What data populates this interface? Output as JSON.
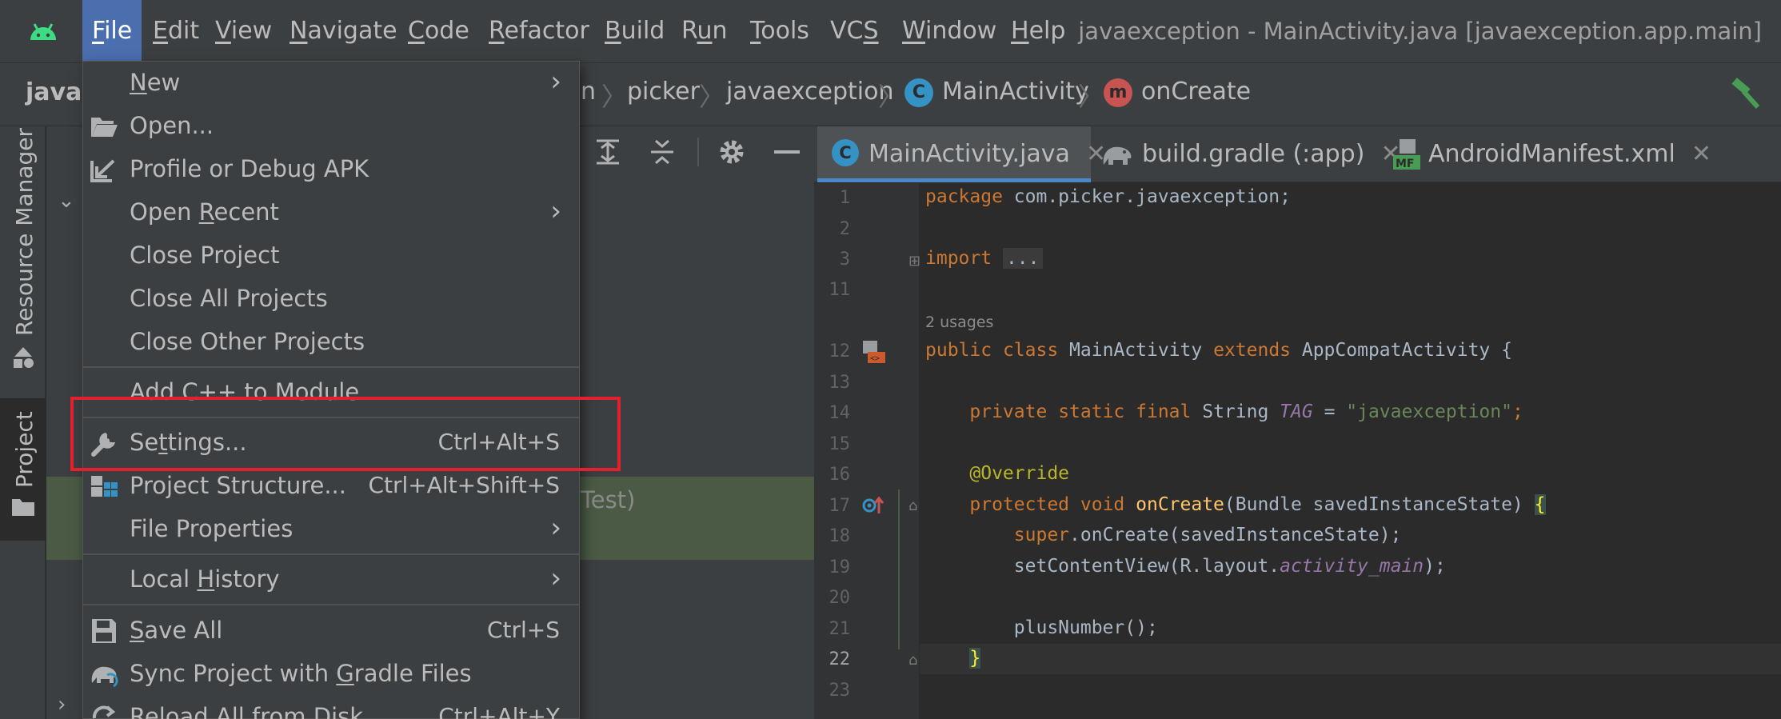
{
  "menubar": {
    "items": [
      {
        "label": "File",
        "mnemonic": "F",
        "rest": "ile"
      },
      {
        "label": "Edit",
        "mnemonic": "E",
        "rest": "dit"
      },
      {
        "label": "View",
        "mnemonic": "V",
        "rest": "iew"
      },
      {
        "label": "Navigate",
        "mnemonic": "N",
        "rest": "avigate"
      },
      {
        "label": "Code",
        "mnemonic": "C",
        "rest": "ode"
      },
      {
        "label": "Refactor",
        "mnemonic": "R",
        "rest": "efactor"
      },
      {
        "label": "Build",
        "mnemonic": "B",
        "rest": "uild"
      },
      {
        "label": "Run",
        "pre": "R",
        "mnemonic": "u",
        "rest": "n"
      },
      {
        "label": "Tools",
        "mnemonic": "T",
        "rest": "ools"
      },
      {
        "label": "VCS",
        "pre": "VC",
        "mnemonic": "S",
        "rest": ""
      },
      {
        "label": "Window",
        "mnemonic": "W",
        "rest": "indow"
      },
      {
        "label": "Help",
        "mnemonic": "H",
        "rest": "elp"
      }
    ],
    "window_title": "javaexception - MainActivity.java [javaexception.app.main]"
  },
  "navbar": {
    "project_name": "javae",
    "crumbs": [
      "n",
      "picker",
      "javaexception",
      "MainActivity",
      "onCreate"
    ],
    "class_badge": "C",
    "method_badge": "m"
  },
  "left_strip": {
    "resource_manager": "Resource Manager",
    "project": "Project"
  },
  "project_panel": {
    "selected_row_text": "Test)"
  },
  "editor": {
    "tabs": [
      {
        "label": "MainActivity.java",
        "icon": "java-class-icon",
        "active": true
      },
      {
        "label": "build.gradle (:app)",
        "icon": "gradle-elephant-icon",
        "active": false
      },
      {
        "label": "AndroidManifest.xml",
        "icon": "manifest-icon",
        "active": false
      }
    ],
    "line_numbers": [
      "1",
      "2",
      "3",
      "11",
      "",
      "12",
      "13",
      "14",
      "15",
      "16",
      "17",
      "18",
      "19",
      "20",
      "21",
      "22",
      "23"
    ],
    "usages_hint": "2 usages",
    "code": {
      "l1_kw": "package",
      "l1_rest": " com.picker.javaexception;",
      "l3_kw": "import",
      "l3_fold": "...",
      "l12_a": "public",
      "l12_b": "class",
      "l12_c": " MainActivity ",
      "l12_d": "extends",
      "l12_e": " AppCompatActivity {",
      "l14_a": "private",
      "l14_b": "static",
      "l14_c": "final",
      "l14_d": " String ",
      "l14_e": "TAG",
      "l14_f": " = ",
      "l14_g": "\"javaexception\"",
      "l14_h": ";",
      "l16": "@Override",
      "l17_a": "protected",
      "l17_b": "void",
      "l17_c": "onCreate",
      "l17_d": "(Bundle savedInstanceState) ",
      "l17_e": "{",
      "l18_a": "super",
      "l18_b": ".onCreate(savedInstanceState);",
      "l19_a": "setContentView(R.layout.",
      "l19_b": "activity_main",
      "l19_c": ");",
      "l21": "plusNumber();",
      "l22": "}"
    }
  },
  "file_menu": {
    "items": [
      {
        "id": "new",
        "label": "New",
        "mn_pre": "",
        "mn": "N",
        "mn_post": "ew",
        "shortcut": "",
        "submenu": true,
        "icon": ""
      },
      {
        "id": "open",
        "label": "Open...",
        "mn_pre": "",
        "mn": "",
        "mn_post": "Open...",
        "shortcut": "",
        "submenu": false,
        "icon": "folder-open-icon"
      },
      {
        "id": "profile",
        "label": "Profile or Debug APK",
        "mn_pre": "",
        "mn": "",
        "mn_post": "Profile or Debug APK",
        "shortcut": "",
        "submenu": false,
        "icon": "import-apk-icon"
      },
      {
        "id": "recent",
        "label": "Open Recent",
        "mn_pre": "Open ",
        "mn": "R",
        "mn_post": "ecent",
        "shortcut": "",
        "submenu": true,
        "icon": ""
      },
      {
        "id": "close-project",
        "label": "Close Project",
        "mn_pre": "",
        "mn": "",
        "mn_post": "Close Project",
        "shortcut": "",
        "submenu": false,
        "icon": ""
      },
      {
        "id": "close-all",
        "label": "Close All Projects",
        "mn_pre": "",
        "mn": "",
        "mn_post": "Close All Projects",
        "shortcut": "",
        "submenu": false,
        "icon": ""
      },
      {
        "id": "close-other",
        "label": "Close Other Projects",
        "mn_pre": "",
        "mn": "",
        "mn_post": "Close Other Projects",
        "shortcut": "",
        "submenu": false,
        "icon": ""
      },
      {
        "id": "add-cpp",
        "label": "Add C++ to Module",
        "mn_pre": "",
        "mn": "",
        "mn_post": "Add C++ to Module",
        "shortcut": "",
        "submenu": false,
        "icon": ""
      },
      {
        "id": "settings",
        "label": "Settings...",
        "mn_pre": "Se",
        "mn": "t",
        "mn_post": "tings...",
        "shortcut": "Ctrl+Alt+S",
        "submenu": false,
        "icon": "wrench-icon"
      },
      {
        "id": "project-structure",
        "label": "Project Structure...",
        "mn_pre": "",
        "mn": "",
        "mn_post": "Project Structure...",
        "shortcut": "Ctrl+Alt+Shift+S",
        "submenu": false,
        "icon": "project-structure-icon"
      },
      {
        "id": "file-properties",
        "label": "File Properties",
        "mn_pre": "",
        "mn": "",
        "mn_post": "File Properties",
        "shortcut": "",
        "submenu": true,
        "icon": ""
      },
      {
        "id": "local-history",
        "label": "Local History",
        "mn_pre": "Local ",
        "mn": "H",
        "mn_post": "istory",
        "shortcut": "",
        "submenu": true,
        "icon": ""
      },
      {
        "id": "save-all",
        "label": "Save All",
        "mn_pre": "",
        "mn": "S",
        "mn_post": "ave All",
        "shortcut": "Ctrl+S",
        "submenu": false,
        "icon": "save-icon"
      },
      {
        "id": "sync",
        "label": "Sync Project with Gradle Files",
        "mn_pre": "Sync Project with ",
        "mn": "G",
        "mn_post": "radle Files",
        "shortcut": "",
        "submenu": false,
        "icon": "gradle-sync-icon"
      },
      {
        "id": "reload",
        "label": "Reload All from Disk",
        "mn_pre": "Reload All from Disk",
        "mn": "",
        "mn_post": "",
        "shortcut": "Ctrl+Alt+Y",
        "submenu": false,
        "icon": "reload-icon"
      }
    ]
  },
  "colors": {
    "menu_active": "#4b6eaf",
    "highlight_box": "#e3202e",
    "keyword": "#cc7832",
    "string": "#6a8759",
    "annotation": "#bbb529",
    "method": "#ffc66d",
    "field": "#9876aa",
    "android_green": "#3ddc84"
  }
}
